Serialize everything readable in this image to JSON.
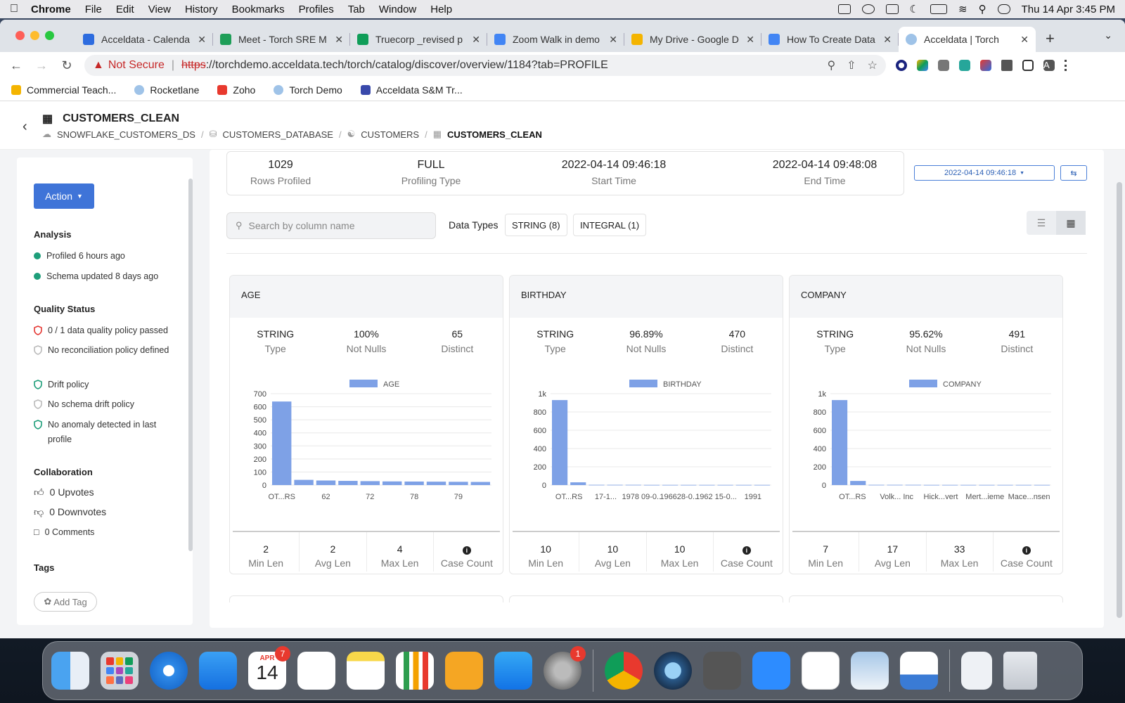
{
  "menubar": {
    "app": "Chrome",
    "items": [
      "File",
      "Edit",
      "View",
      "History",
      "Bookmarks",
      "Profiles",
      "Tab",
      "Window",
      "Help"
    ],
    "datetime": "Thu 14 Apr  3:45 PM"
  },
  "browser": {
    "tabs": [
      {
        "title": "Acceldata - Calenda",
        "color": "#2d6cdf"
      },
      {
        "title": "Meet - Torch SRE M",
        "color": "#1e9e58"
      },
      {
        "title": "Truecorp _revised p",
        "color": "#0f9d58"
      },
      {
        "title": "Zoom Walk in demo",
        "color": "#4285f4"
      },
      {
        "title": "My Drive - Google D",
        "color": "#f4b400"
      },
      {
        "title": "How To Create Data",
        "color": "#4285f4"
      },
      {
        "title": "Acceldata | Torch",
        "color": "#9fc3e8"
      }
    ],
    "url_warning": "Not Secure",
    "url_scheme": "https",
    "url_rest": "://torchdemo.acceldata.tech/torch/catalog/discover/overview/1184?tab=PROFILE",
    "avatar": "A",
    "bookmarks": [
      {
        "label": "Commercial Teach...",
        "color": "#f4b400"
      },
      {
        "label": "Rocketlane",
        "color": "#9fc3e8"
      },
      {
        "label": "Zoho",
        "color": "#e8392e"
      },
      {
        "label": "Torch Demo",
        "color": "#9fc3e8"
      },
      {
        "label": "Acceldata S&M Tr...",
        "color": "#3949ab"
      }
    ]
  },
  "page": {
    "title": "CUSTOMERS_CLEAN",
    "breadcrumb": [
      "SNOWFLAKE_CUSTOMERS_DS",
      "CUSTOMERS_DATABASE",
      "CUSTOMERS",
      "CUSTOMERS_CLEAN"
    ]
  },
  "sidebar": {
    "action_label": "Action",
    "analysis_heading": "Analysis",
    "analysis": [
      "Profiled 6 hours ago",
      "Schema updated 8 days ago"
    ],
    "quality_heading": "Quality Status",
    "quality": [
      {
        "label": "0 / 1 data quality policy passed",
        "status": "fail"
      },
      {
        "label": "No reconciliation policy defined",
        "status": "none"
      },
      {
        "label": "Drift policy",
        "status": "ok"
      },
      {
        "label": "No schema drift policy",
        "status": "none"
      },
      {
        "label": "No anomaly detected in last profile",
        "status": "ok"
      }
    ],
    "collab_heading": "Collaboration",
    "upvotes": "0 Upvotes",
    "downvotes": "0 Downvotes",
    "comments": "0 Comments",
    "tags_heading": "Tags",
    "add_tag": "Add Tag"
  },
  "summary": {
    "rows": {
      "value": "1029",
      "label": "Rows Profiled"
    },
    "type": {
      "value": "FULL",
      "label": "Profiling Type"
    },
    "start": {
      "value": "2022-04-14 09:46:18",
      "label": "Start Time"
    },
    "end": {
      "value": "2022-04-14 09:48:08",
      "label": "End Time"
    },
    "date_select": "2022-04-14 09:46:18"
  },
  "filters": {
    "search_placeholder": "Search by column name",
    "data_types_label": "Data Types",
    "chips": [
      "STRING (8)",
      "INTEGRAL (1)"
    ]
  },
  "cards": [
    {
      "name": "AGE",
      "stats": [
        {
          "v": "STRING",
          "l": "Type"
        },
        {
          "v": "100%",
          "l": "Not Nulls"
        },
        {
          "v": "65",
          "l": "Distinct"
        }
      ],
      "foot": [
        {
          "v": "2",
          "l": "Min Len"
        },
        {
          "v": "2",
          "l": "Avg Len"
        },
        {
          "v": "4",
          "l": "Max Len"
        },
        {
          "v": "i",
          "l": "Case Count"
        }
      ]
    },
    {
      "name": "BIRTHDAY",
      "stats": [
        {
          "v": "STRING",
          "l": "Type"
        },
        {
          "v": "96.89%",
          "l": "Not Nulls"
        },
        {
          "v": "470",
          "l": "Distinct"
        }
      ],
      "foot": [
        {
          "v": "10",
          "l": "Min Len"
        },
        {
          "v": "10",
          "l": "Avg Len"
        },
        {
          "v": "10",
          "l": "Max Len"
        },
        {
          "v": "i",
          "l": "Case Count"
        }
      ]
    },
    {
      "name": "COMPANY",
      "stats": [
        {
          "v": "STRING",
          "l": "Type"
        },
        {
          "v": "95.62%",
          "l": "Not Nulls"
        },
        {
          "v": "491",
          "l": "Distinct"
        }
      ],
      "foot": [
        {
          "v": "7",
          "l": "Min Len"
        },
        {
          "v": "17",
          "l": "Avg Len"
        },
        {
          "v": "33",
          "l": "Max Len"
        },
        {
          "v": "i",
          "l": "Case Count"
        }
      ]
    }
  ],
  "chart_data": [
    {
      "type": "bar",
      "series_name": "AGE",
      "ylim": [
        0,
        700
      ],
      "yticks": [
        "0",
        "100",
        "200",
        "300",
        "400",
        "500",
        "600",
        "700"
      ],
      "values": [
        640,
        40,
        35,
        32,
        30,
        28,
        27,
        26,
        25,
        24
      ],
      "tick_labels": [
        "__OT...RS__",
        "",
        "62",
        "",
        "72",
        "",
        "78",
        "",
        "79",
        ""
      ]
    },
    {
      "type": "bar",
      "series_name": "BIRTHDAY",
      "ylim": [
        0,
        1000
      ],
      "yticks": [
        "0",
        "200",
        "400",
        "600",
        "800",
        "1k"
      ],
      "values": [
        930,
        30,
        3,
        3,
        3,
        2,
        2,
        2,
        2,
        2,
        2,
        2
      ],
      "tick_labels": [
        "__OT...RS__",
        "17-1...",
        "1978 09-0...",
        "196628-0...",
        "1962 15-0...",
        "1991"
      ]
    },
    {
      "type": "bar",
      "series_name": "COMPANY",
      "ylim": [
        0,
        1000
      ],
      "yticks": [
        "0",
        "200",
        "400",
        "600",
        "800",
        "1k"
      ],
      "values": [
        930,
        45,
        3,
        3,
        3,
        2,
        2,
        2,
        2,
        2,
        2,
        2
      ],
      "tick_labels": [
        "__OT...RS__",
        "Volk... Inc",
        "Hick...yert",
        "Mert...ieme",
        "Mace...nsen"
      ]
    }
  ],
  "dock": {
    "calendar_month": "APR",
    "calendar_day": "14",
    "calendar_badge": "7",
    "settings_badge": "1",
    "apps": [
      "Finder",
      "Launchpad",
      "Safari",
      "Mail",
      "Calendar",
      "Reminders",
      "Notes",
      "Numbers",
      "Pages",
      "App Store",
      "System Preferences",
      "Chrome",
      "QuickTime",
      "Calculator",
      "Zoom",
      "Slack",
      "Preview",
      "Keynote",
      "Document",
      "Trash"
    ]
  }
}
